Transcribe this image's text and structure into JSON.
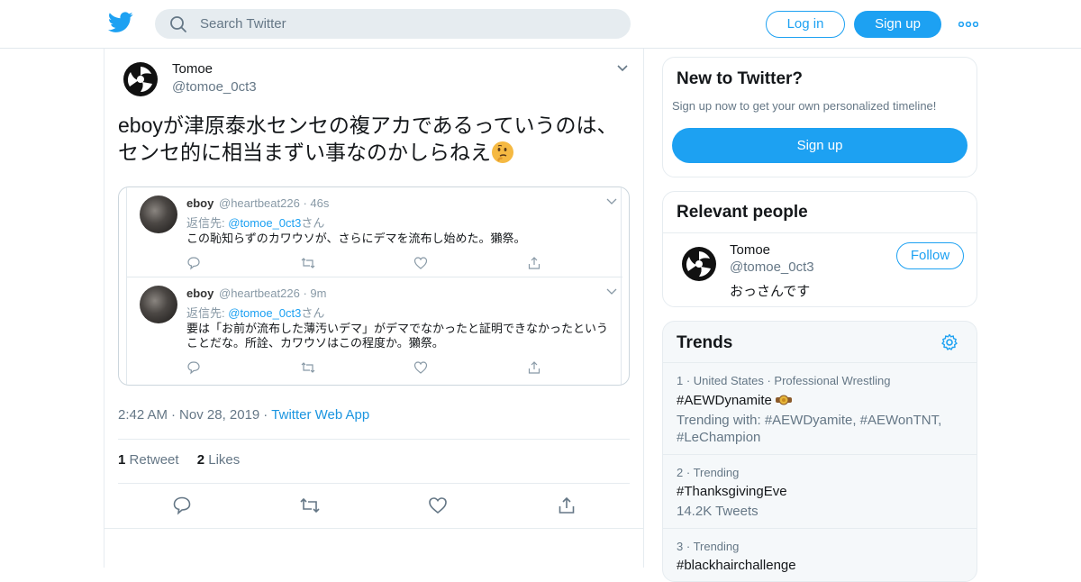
{
  "search": {
    "placeholder": "Search Twitter"
  },
  "nav": {
    "login_label": "Log in",
    "signup_label": "Sign up"
  },
  "tweet": {
    "author_name": "Tomoe",
    "author_handle": "@tomoe_0ct3",
    "text": "eboyが津原泰水センセの複アカであるっていうのは、センセ的に相当まずい事なのかしらねえ",
    "time": "2:42 AM",
    "date": "Nov 28, 2019",
    "source": "Twitter Web App",
    "retweet_count": "1",
    "retweet_label": "Retweet",
    "like_count": "2",
    "like_label": "Likes"
  },
  "quoted": [
    {
      "name": "eboy",
      "handle": "@heartbeat226",
      "time": "46s",
      "reply_prefix": "返信先:",
      "reply_handle": "@tomoe_0ct3",
      "reply_suffix": "さん",
      "text": "この恥知らずのカワウソが、さらにデマを流布し始めた。獺祭。"
    },
    {
      "name": "eboy",
      "handle": "@heartbeat226",
      "time": "9m",
      "reply_prefix": "返信先:",
      "reply_handle": "@tomoe_0ct3",
      "reply_suffix": "さん",
      "text": "要は「お前が流布した薄汚いデマ」がデマでなかったと証明できなかったということだな。所詮、カワウソはこの程度か。獺祭。"
    }
  ],
  "new_to_twitter": {
    "title": "New to Twitter?",
    "subtitle": "Sign up now to get your own personalized timeline!",
    "button": "Sign up"
  },
  "relevant": {
    "title": "Relevant people",
    "name": "Tomoe",
    "handle": "@tomoe_0ct3",
    "bio": "おっさんです",
    "follow": "Follow"
  },
  "trends": {
    "title": "Trends",
    "items": [
      {
        "rank": "1",
        "context": "United States · Professional Wrestling",
        "tag": "#AEWDynamite",
        "sub": "Trending with: #AEWDyamite, #AEWonTNT, #LeChampion"
      },
      {
        "rank": "2",
        "context": "Trending",
        "tag": "#ThanksgivingEve",
        "sub": "14.2K Tweets"
      },
      {
        "rank": "3",
        "context": "Trending",
        "tag": "#blackhairchallenge",
        "sub": ""
      }
    ]
  },
  "colors": {
    "accent": "#1da1f2",
    "text": "#14171a",
    "muted": "#657786"
  }
}
